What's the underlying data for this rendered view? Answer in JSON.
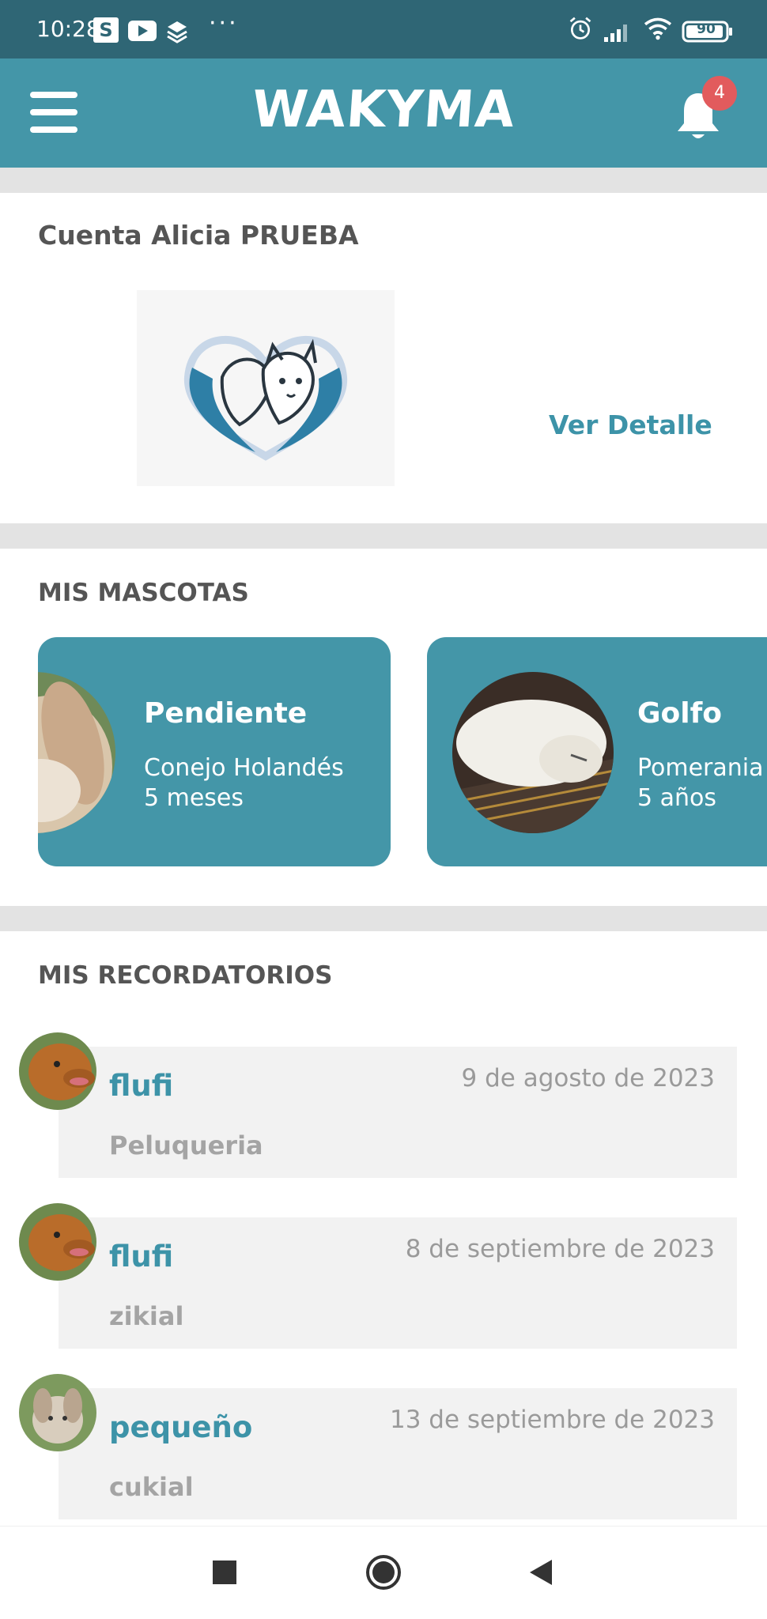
{
  "status_bar": {
    "time": "10:28",
    "battery": "90",
    "app_icon_letter": "S",
    "more": "···"
  },
  "header": {
    "logo": "WAKYMA",
    "notification_count": "4"
  },
  "account": {
    "title": "Cuenta Alicia PRUEBA",
    "detail_link": "Ver Detalle"
  },
  "pets": {
    "title": "MIS MASCOTAS",
    "items": [
      {
        "name": "Pendiente",
        "breed": "Conejo Holandés",
        "age": "5 meses"
      },
      {
        "name": "Golfo",
        "breed": "Pomerania",
        "age": "5 años"
      }
    ]
  },
  "reminders": {
    "title": "MIS RECORDATORIOS",
    "items": [
      {
        "pet": "flufi",
        "date": "9 de agosto de 2023",
        "type": "Peluqueria"
      },
      {
        "pet": "flufi",
        "date": "8 de septiembre de 2023",
        "type": "zikial"
      },
      {
        "pet": "pequeño",
        "date": "13 de septiembre de 2023",
        "type": "cukial"
      }
    ]
  },
  "colors": {
    "primary": "#4496a8",
    "status_bar": "#2f6675",
    "badge": "#e25b5d",
    "link": "#3d93a8"
  },
  "icons": [
    "menu-icon",
    "bell-icon",
    "heart-pets-logo-icon",
    "nav-recents-icon",
    "nav-home-icon",
    "nav-back-icon"
  ]
}
